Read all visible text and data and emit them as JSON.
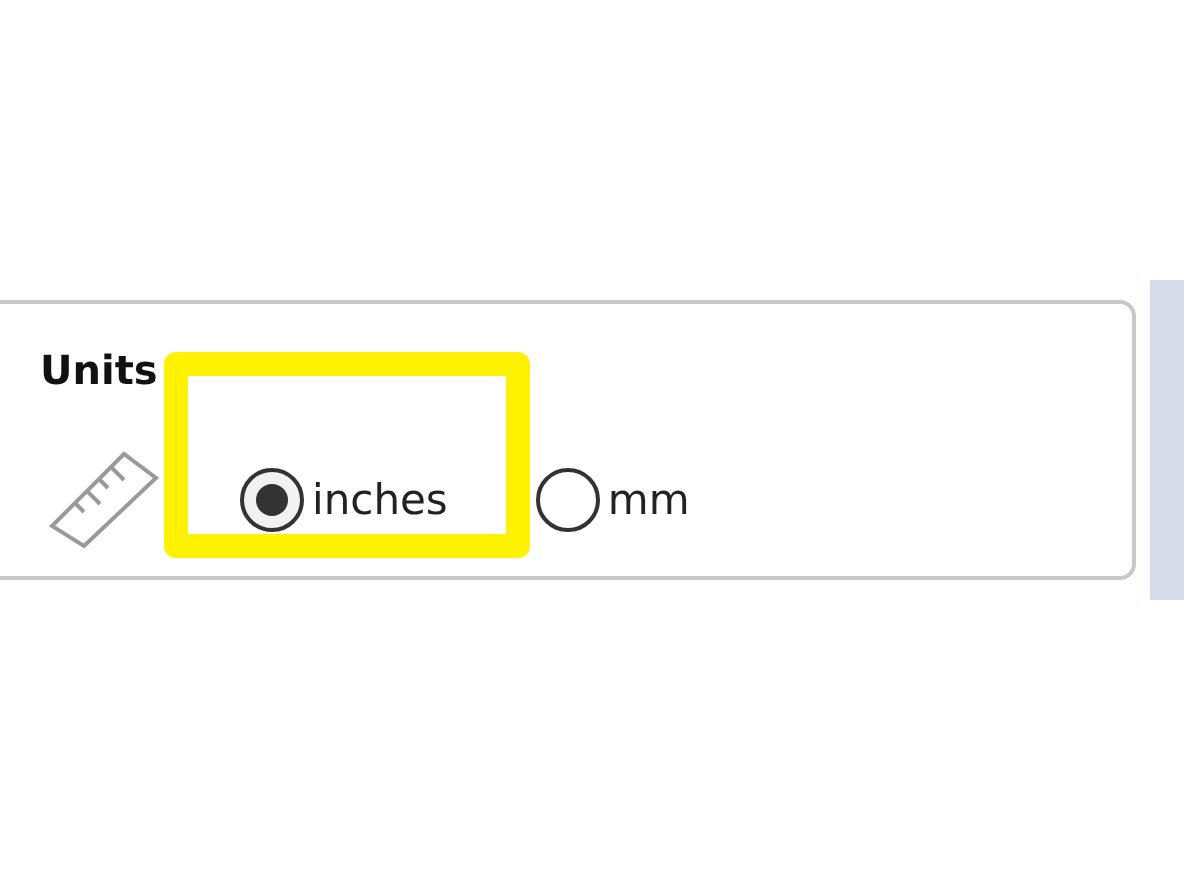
{
  "group": {
    "title": "Units",
    "options": [
      {
        "label": "inches",
        "selected": true,
        "highlighted": true
      },
      {
        "label": "mm",
        "selected": false,
        "highlighted": false
      }
    ]
  }
}
